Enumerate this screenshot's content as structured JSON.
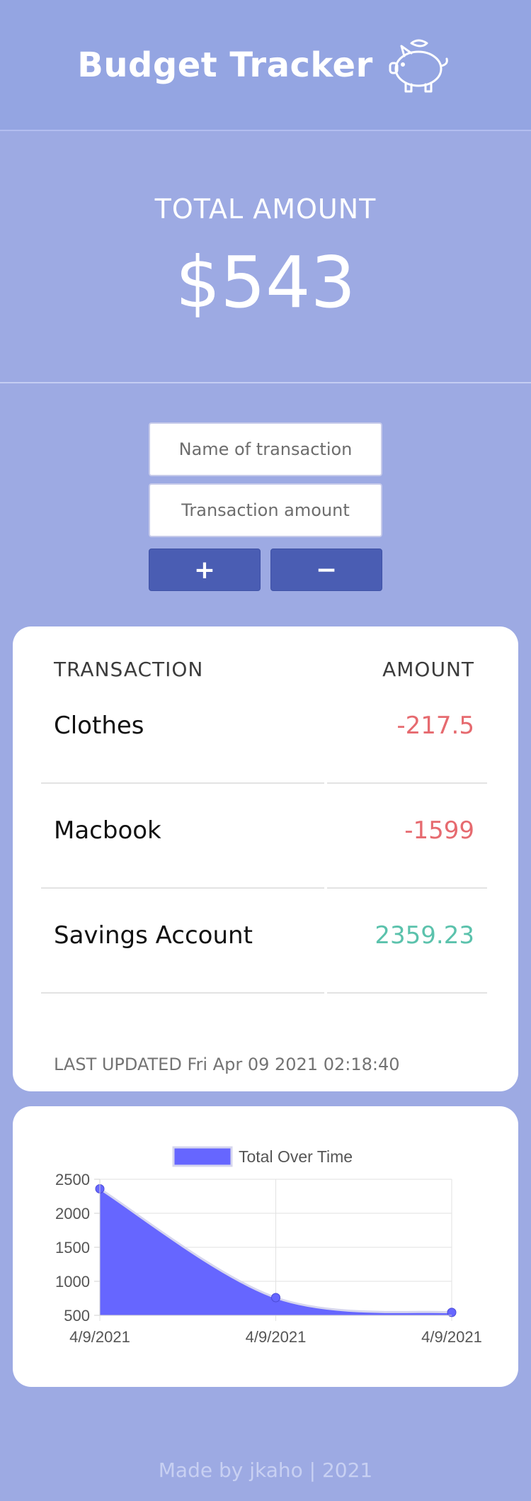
{
  "app": {
    "title": "Budget Tracker",
    "logo_icon": "piggy-bank-icon"
  },
  "total": {
    "label": "TOTAL AMOUNT",
    "value": "$543"
  },
  "form": {
    "name_placeholder": "Name of transaction",
    "amount_placeholder": "Transaction amount",
    "add_label": "+",
    "subtract_label": "−"
  },
  "table": {
    "headers": {
      "name": "TRANSACTION",
      "amount": "AMOUNT"
    },
    "rows": [
      {
        "name": "Clothes",
        "amount": "-217.5",
        "kind": "expense"
      },
      {
        "name": "Macbook",
        "amount": "-1599",
        "kind": "expense"
      },
      {
        "name": "Savings Account",
        "amount": "2359.23",
        "kind": "income"
      }
    ],
    "last_updated": "LAST UPDATED Fri Apr 09 2021 02:18:40"
  },
  "colors": {
    "expense": "#e66a6f",
    "income": "#5bc2ac",
    "accent": "#4a5db3",
    "series_fill": "#6666ff"
  },
  "chart_data": {
    "type": "area",
    "x": [
      "4/9/2021",
      "4/9/2021",
      "4/9/2021"
    ],
    "series": [
      {
        "name": "Total Over Time",
        "values": [
          2359.23,
          760.23,
          542.73
        ]
      }
    ],
    "ylim": [
      500,
      2500
    ],
    "yticks": [
      500,
      1000,
      1500,
      2000,
      2500
    ],
    "grid": true,
    "legend": "top-center"
  },
  "footer": {
    "text": "Made by jkaho | 2021"
  }
}
